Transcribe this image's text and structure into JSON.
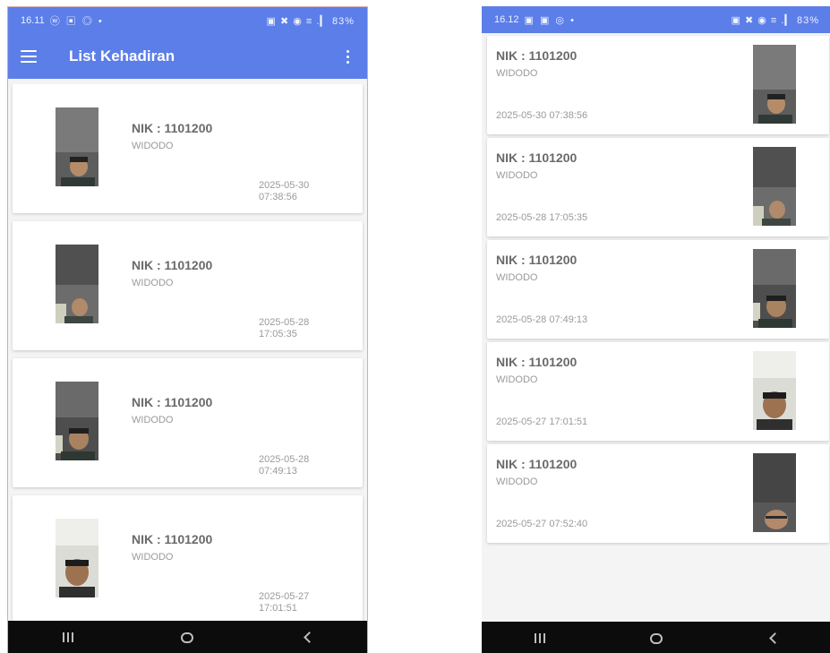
{
  "left_screen": {
    "status": {
      "time": "16.11",
      "left_icons": "ⓦ ▣ ◎ •",
      "right_icons": "▣ ✖ ◉ ≡ .▎",
      "battery": "83%"
    },
    "appbar": {
      "title": "List Kehadiran"
    },
    "records": [
      {
        "nik": "NIK : 1101200",
        "name": "WIDODO",
        "timestamp": "2025-05-30 07:38:56"
      },
      {
        "nik": "NIK : 1101200",
        "name": "WIDODO",
        "timestamp": "2025-05-28 17:05:35"
      },
      {
        "nik": "NIK : 1101200",
        "name": "WIDODO",
        "timestamp": "2025-05-28 07:49:13"
      },
      {
        "nik": "NIK : 1101200",
        "name": "WIDODO",
        "timestamp": "2025-05-27 17:01:51"
      }
    ]
  },
  "right_screen": {
    "status": {
      "time": "16.12",
      "left_icons": "▣ ▣ ◎ •",
      "right_icons": "▣ ✖ ◉ ≡ .▎",
      "battery": "83%"
    },
    "records": [
      {
        "nik": "NIK : 1101200",
        "name": "WIDODO",
        "timestamp": "2025-05-30 07:38:56"
      },
      {
        "nik": "NIK : 1101200",
        "name": "WIDODO",
        "timestamp": "2025-05-28 17:05:35"
      },
      {
        "nik": "NIK : 1101200",
        "name": "WIDODO",
        "timestamp": "2025-05-28 07:49:13"
      },
      {
        "nik": "NIK : 1101200",
        "name": "WIDODO",
        "timestamp": "2025-05-27 17:01:51"
      },
      {
        "nik": "NIK : 1101200",
        "name": "WIDODO",
        "timestamp": "2025-05-27 07:52:40"
      }
    ]
  },
  "colors": {
    "appbar": "#5c7ee9",
    "navbar": "#0c0c0c",
    "card": "#ffffff",
    "list_bg": "#f4f4f4"
  },
  "icons": {
    "menu": "hamburger-icon",
    "more": "more-vert-icon",
    "nav_recents": "recents-icon",
    "nav_home": "home-icon",
    "nav_back": "back-icon"
  }
}
